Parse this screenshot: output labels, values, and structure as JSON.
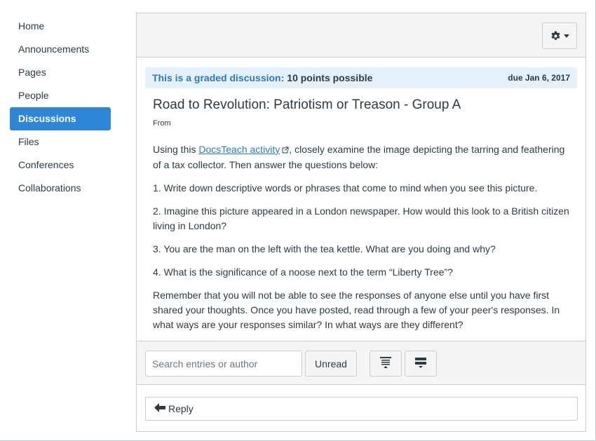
{
  "sidebar": {
    "items": [
      {
        "label": "Home"
      },
      {
        "label": "Announcements"
      },
      {
        "label": "Pages"
      },
      {
        "label": "People"
      },
      {
        "label": "Discussions"
      },
      {
        "label": "Files"
      },
      {
        "label": "Conferences"
      },
      {
        "label": "Collaborations"
      }
    ],
    "active_index": 4
  },
  "header": {
    "settings_icon": "gear-icon",
    "dropdown_icon": "caret-down-icon"
  },
  "graded": {
    "label": "This is a graded discussion:",
    "points": "10 points possible",
    "due": "due Jan 6, 2017"
  },
  "discussion": {
    "title": "Road to Revolution: Patriotism or Treason - Group A",
    "from": "From",
    "intro_before": "Using this ",
    "link_text": "DocsTeach activity",
    "intro_after": ", closely examine the image depicting the tarring and feathering of a tax collector. Then answer the questions below:",
    "q1": "1. Write down descriptive words or phrases that come to mind when you see this picture.",
    "q2": "2. Imagine this picture appeared in a London newspaper. How would this look to a British citizen living in London?",
    "q3": "3. You are the man on the left with the tea kettle. What are you doing and why?",
    "q4": "4. What is the significance of a noose next to the term “Liberty Tree”?",
    "closing": "Remember that you will not be able to see the responses of anyone else until you have first shared your thoughts. Once you have posted, read through a few of your peer's responses. In what ways are your responses similar? In what ways are they different?"
  },
  "toolbar": {
    "search_placeholder": "Search entries or author",
    "search_value": "",
    "unread_label": "Unread",
    "expand_icon": "expand-all-icon",
    "collapse_icon": "collapse-all-icon"
  },
  "reply": {
    "label": "Reply",
    "icon": "reply-arrow-icon"
  },
  "colors": {
    "accent": "#2d86d6",
    "link": "#2b7abc",
    "graded_bg": "#e5f1fb",
    "text": "#2d3b45",
    "border": "#c7cdd1"
  }
}
